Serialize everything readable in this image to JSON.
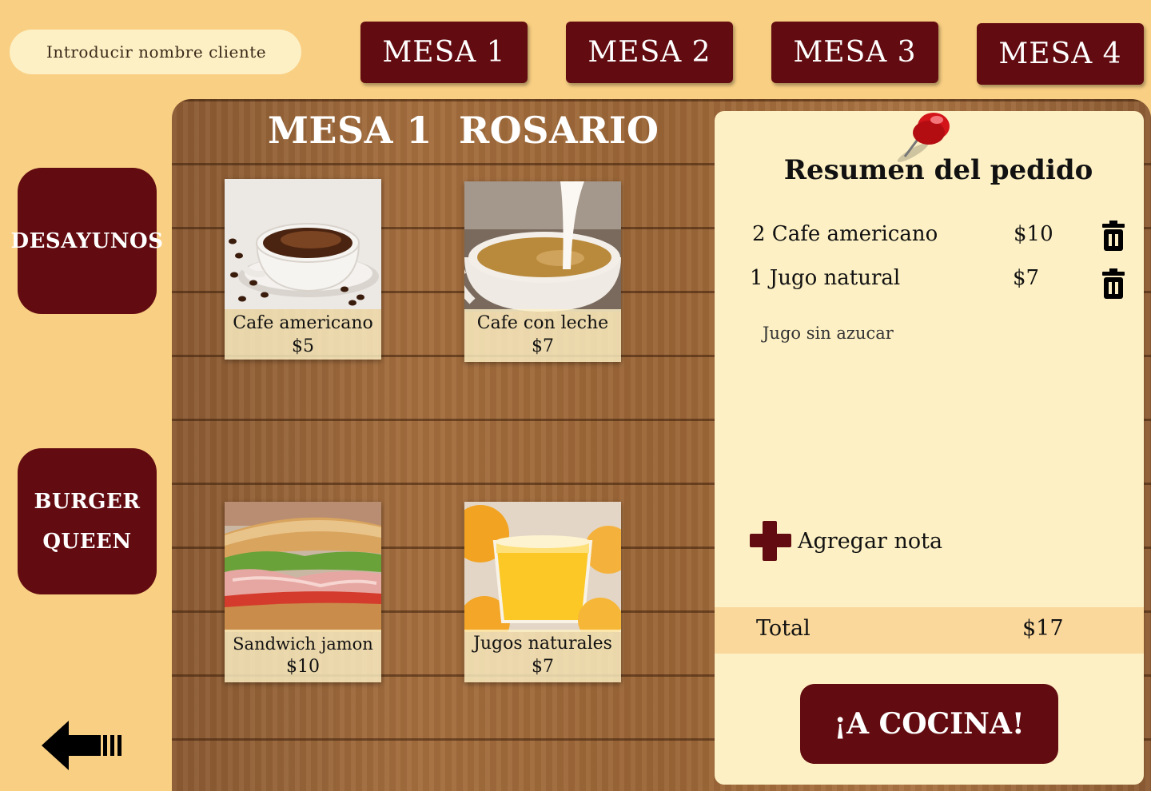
{
  "client_input": {
    "placeholder": "Introducir nombre cliente"
  },
  "tables": [
    {
      "label": "MESA 1"
    },
    {
      "label": "MESA 2"
    },
    {
      "label": "MESA 3"
    },
    {
      "label": "MESA 4"
    }
  ],
  "sidebar": {
    "desayunos": "DESAYUNOS",
    "burger_line1": "BURGER",
    "burger_line2": "QUEEN"
  },
  "board": {
    "title": "MESA 1  ROSARIO"
  },
  "products": [
    {
      "name": "Cafe americano",
      "price": "$5"
    },
    {
      "name": "Cafe con leche",
      "price": "$7"
    },
    {
      "name": "Sandwich jamon",
      "price": "$10"
    },
    {
      "name": "Jugos naturales",
      "price": "$7"
    }
  ],
  "summary": {
    "title": "Resumen del pedido",
    "items": [
      {
        "name": "2 Cafe americano",
        "price": "$10"
      },
      {
        "name": "1 Jugo natural",
        "price": "$7"
      }
    ],
    "note": "Jugo sin azucar",
    "add_note_label": "Agregar nota",
    "total_label": "Total",
    "total_value": "$17",
    "send_button": "¡A COCINA!"
  },
  "colors": {
    "background": "#f9cf83",
    "accent": "#620b10",
    "panel": "#fdf0c4"
  },
  "icons": [
    "trash-icon",
    "plus-icon",
    "back-arrow-icon",
    "pushpin-icon"
  ]
}
